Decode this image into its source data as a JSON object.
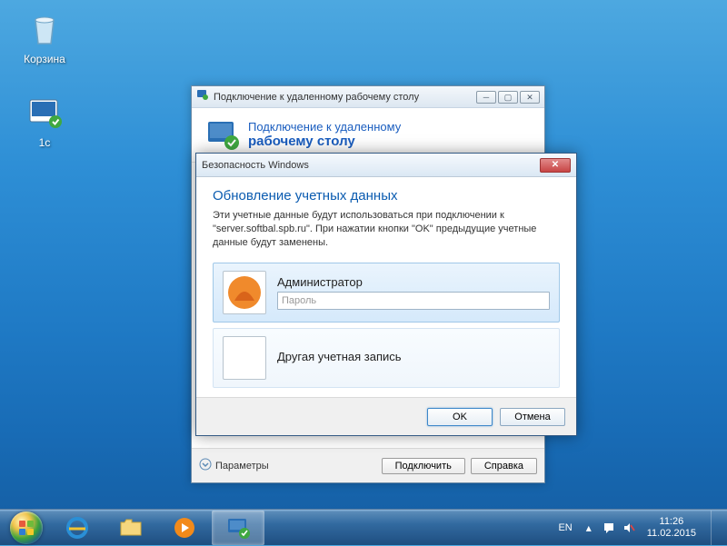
{
  "desktop": {
    "icons": [
      {
        "name": "Корзина"
      },
      {
        "name": "1c"
      }
    ]
  },
  "rdp": {
    "title": "Подключение к удаленному рабочему столу",
    "header_line1": "Подключение к удаленному",
    "header_line2": "рабочему столу",
    "footer": {
      "params": "Параметры",
      "connect": "Подключить",
      "help": "Справка"
    }
  },
  "security": {
    "title": "Безопасность Windows",
    "heading": "Обновление учетных данных",
    "description": "Эти учетные данные будут использоваться при подключении к \"server.softbal.spb.ru\". При нажатии кнопки \"OK\" предыдущие учетные данные будут заменены.",
    "accounts": {
      "admin": {
        "name": "Администратор",
        "password_placeholder": "Пароль"
      },
      "other": {
        "name": "Другая учетная запись"
      }
    },
    "buttons": {
      "ok": "OK",
      "cancel": "Отмена"
    }
  },
  "taskbar": {
    "lang": "EN",
    "time": "11:26",
    "date": "11.02.2015"
  }
}
